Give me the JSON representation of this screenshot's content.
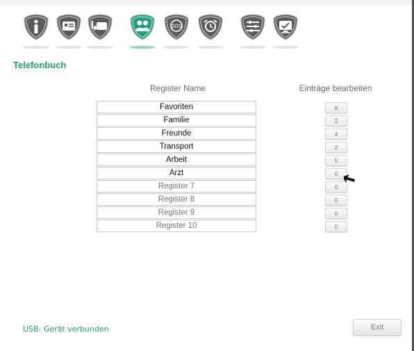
{
  "toolbar": {
    "items": [
      {
        "icon": "info-icon",
        "active": false
      },
      {
        "icon": "contact-card-icon",
        "active": false
      },
      {
        "icon": "phone-return-icon",
        "active": false
      },
      {
        "icon": "phonebook-contacts-icon",
        "active": true
      },
      {
        "icon": "sos-icon",
        "active": false
      },
      {
        "icon": "alarm-clock-icon",
        "active": false
      },
      {
        "icon": "sliders-settings-icon",
        "active": false
      },
      {
        "icon": "monitor-icon",
        "active": false
      }
    ],
    "active_color": "#1f9c7c",
    "inactive_color": "#5a5a5a",
    "sos_text": "SOS"
  },
  "page": {
    "title": "Telefonbuch"
  },
  "columns": {
    "name": "Register Name",
    "edit": "Einträge bearbeiten"
  },
  "registers": [
    {
      "name": "Favoriten",
      "count": "6"
    },
    {
      "name": "Familie",
      "count": "2"
    },
    {
      "name": "Freunde",
      "count": "4"
    },
    {
      "name": "Transport",
      "count": "2"
    },
    {
      "name": "Arbeit",
      "count": "5"
    },
    {
      "name": "Arzt",
      "count": "0"
    },
    {
      "name": "Register 7",
      "count": "0"
    },
    {
      "name": "Register 8",
      "count": "0"
    },
    {
      "name": "Register 9",
      "count": "0"
    },
    {
      "name": "Register 10",
      "count": "0"
    }
  ],
  "status": {
    "text": "USB: Gerät verbunden"
  },
  "exit": {
    "label": "Exit"
  }
}
